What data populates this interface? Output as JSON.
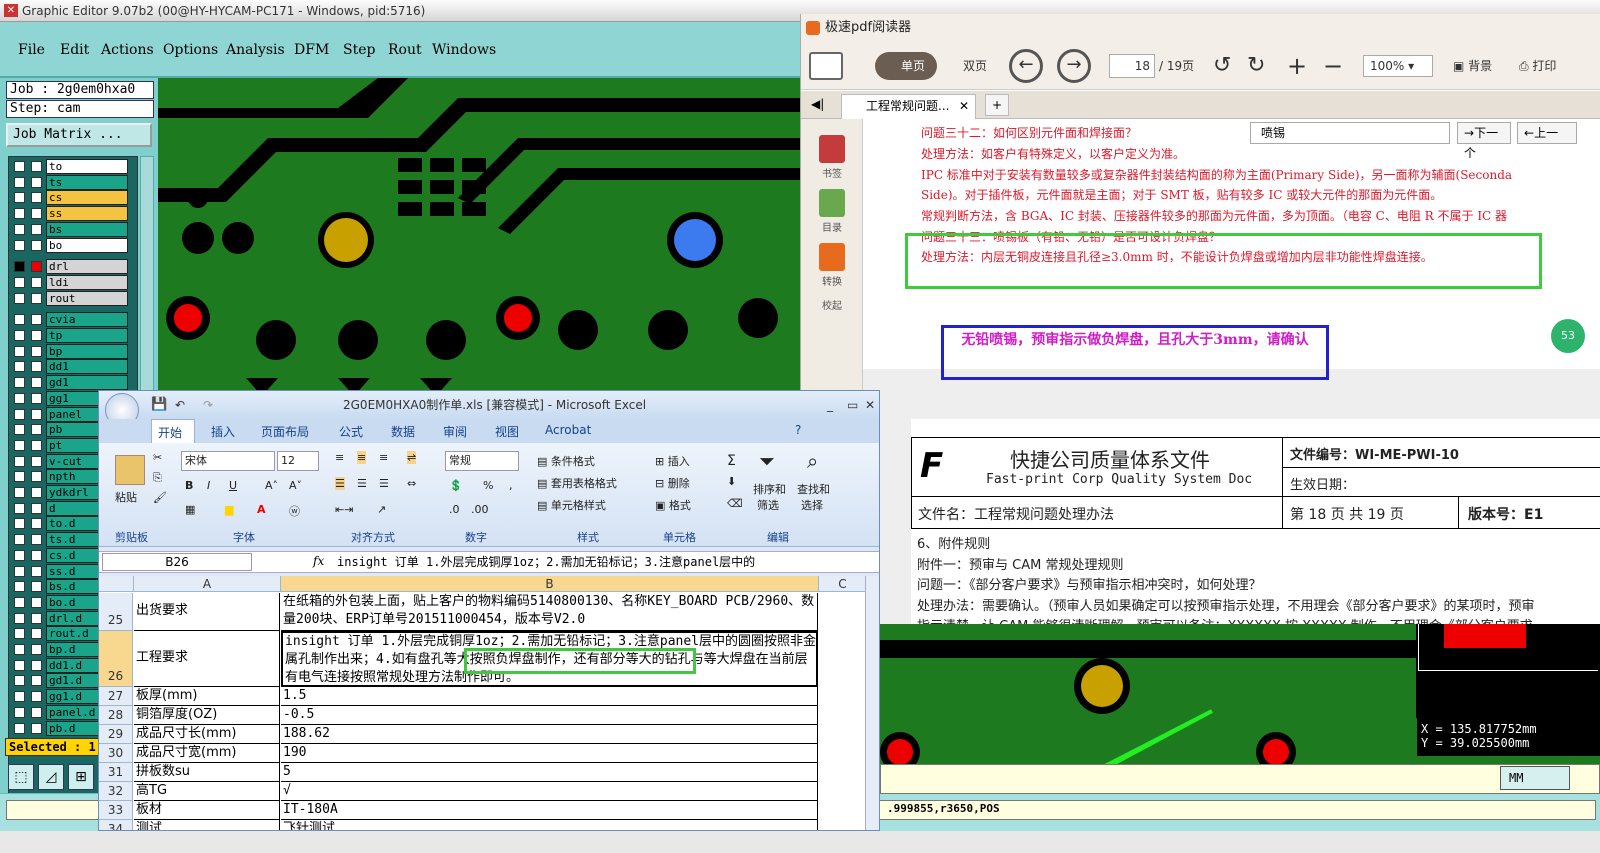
{
  "genesis": {
    "title": "Graphic Editor 9.07b2 (00@HY-HYCAM-PC171 - Windows, pid:5716)",
    "menu": [
      "File",
      "Edit",
      "Actions",
      "Options",
      "Analysis",
      "DFM",
      "Step",
      "Rout",
      "Windows"
    ],
    "job": "Job : 2g0em0hxa0",
    "step": "Step: cam",
    "job_matrix": "Job Matrix ...",
    "layers": [
      {
        "name": "to",
        "color": "#ffffff"
      },
      {
        "name": "ts",
        "color": "#1aa58a"
      },
      {
        "name": "cs",
        "color": "#f5c342"
      },
      {
        "name": "ss",
        "color": "#f5c342"
      },
      {
        "name": "bs",
        "color": "#1aa58a"
      },
      {
        "name": "bo",
        "color": "#ffffff"
      },
      {
        "name": "drl",
        "color": "#d4d4d4"
      },
      {
        "name": "ldi",
        "color": "#d4d4d4"
      },
      {
        "name": "rout",
        "color": "#d4d4d4"
      },
      {
        "name": "cvia",
        "color": "#1aa58a"
      },
      {
        "name": "tp",
        "color": "#1aa58a"
      },
      {
        "name": "bp",
        "color": "#1aa58a"
      },
      {
        "name": "dd1",
        "color": "#1aa58a"
      },
      {
        "name": "gd1",
        "color": "#1aa58a"
      },
      {
        "name": "gg1",
        "color": "#1aa58a"
      },
      {
        "name": "panel",
        "color": "#1aa58a"
      },
      {
        "name": "pb",
        "color": "#1aa58a"
      },
      {
        "name": "pt",
        "color": "#1aa58a"
      },
      {
        "name": "v-cut",
        "color": "#1aa58a"
      },
      {
        "name": "npth",
        "color": "#1aa58a"
      },
      {
        "name": "ydkdrl",
        "color": "#1aa58a"
      },
      {
        "name": "d",
        "color": "#1aa58a"
      },
      {
        "name": "to.d",
        "color": "#1aa58a"
      },
      {
        "name": "ts.d",
        "color": "#1aa58a"
      },
      {
        "name": "cs.d",
        "color": "#1aa58a"
      },
      {
        "name": "ss.d",
        "color": "#1aa58a"
      },
      {
        "name": "bs.d",
        "color": "#1aa58a"
      },
      {
        "name": "bo.d",
        "color": "#1aa58a"
      },
      {
        "name": "drl.d",
        "color": "#1aa58a"
      },
      {
        "name": "rout.d",
        "color": "#1aa58a"
      },
      {
        "name": "bp.d",
        "color": "#1aa58a"
      },
      {
        "name": "dd1.d",
        "color": "#1aa58a"
      },
      {
        "name": "gd1.d",
        "color": "#1aa58a"
      },
      {
        "name": "gg1.d",
        "color": "#1aa58a"
      },
      {
        "name": "panel.d",
        "color": "#1aa58a"
      },
      {
        "name": "pb.d",
        "color": "#1aa58a"
      }
    ],
    "selected": "Selected : 1",
    "coords": [
      "X = 135.817752mm",
      "Y = 39.025500mm"
    ],
    "units": "MM",
    "command": ".999855,r3650,POS"
  },
  "pdf": {
    "title": "极速pdf阅读器",
    "single_page": "单页",
    "double_page": "双页",
    "page_input": "18",
    "page_total": "/ 19页",
    "zoom": "100%",
    "background": "背景",
    "print": "打印",
    "tab": "工程常规问题...",
    "search": "喷锡",
    "next": "下一个",
    "prev": "上一",
    "side": [
      "书签",
      "目录",
      "转换",
      "校起"
    ],
    "lines": [
      "问题三十二：如何区别元件面和焊接面？",
      "处理方法：如客户有特殊定义，以客户定义为准。",
      "IPC 标准中对于安装有数量较多或复杂器件封装结构面的称为主面(Primary Side)，另一面称为辅面(Seconda",
      "Side)。对于插件板，元件面就是主面；对于 SMT 板，贴有较多 IC 或较大元件的那面为元件面。",
      "常规判断方法，含 BGA、IC 封装、压接器件较多的那面为元件面，多为顶面。（电容 C、电阻 R 不属于 IC 器",
      "问题三十三：喷锡板（有铅、无铅）是否可设计负焊盘？",
      "处理方法：内层无铜皮连接且孔径≥3.0mm 时，不能设计负焊盘或增加内层非功能性焊盘连接。"
    ],
    "note": "无铅喷锡，预审指示做负焊盘，且孔大于3mm，请确认",
    "badge": "53",
    "doc": {
      "company_cn": "快捷公司质量体系文件",
      "company_en": "Fast-print Corp Quality System Doc",
      "doc_no": "文件编号：WI-ME-PWI-10",
      "effective": "生效日期：",
      "file_name": "文件名：工程常规问题处理办法",
      "page_info": "第 18 页 共 19 页",
      "version": "版本号：E1",
      "body": [
        "6、附件规则",
        "附件一：预审与 CAM 常规处理规则",
        "问题一：《部分客户要求》与预审指示相冲突时，如何处理？",
        "处理办法：需要确认。（预审人员如果确定可以按预审指示处理，不用理会《部分客户要求》的某项时，预审",
        "指示清楚，让 CAM 能够很清晰理解，预审可以备注：XXXXXX 按 XXXXX 制作，不用理会《部分客户要求"
      ]
    }
  },
  "excel": {
    "title": "2G0EM0HXA0制作单.xls  [兼容模式] - Microsoft Excel",
    "tabs": [
      "开始",
      "插入",
      "页面布局",
      "公式",
      "数据",
      "审阅",
      "视图",
      "Acrobat"
    ],
    "font": "宋体",
    "font_size": "12",
    "number_format": "常规",
    "paste": "粘贴",
    "groups": [
      "剪贴板",
      "字体",
      "对齐方式",
      "数字",
      "样式",
      "单元格",
      "编辑"
    ],
    "style_btns": [
      "条件格式",
      "套用表格格式",
      "单元格样式"
    ],
    "cell_btns": [
      "插入",
      "删除",
      "格式"
    ],
    "edit_btns": [
      "排序和",
      "筛选",
      "查找和",
      "选择"
    ],
    "name_box": "B26",
    "formula": "insight 订单 1.外层完成铜厚1oz；2.需加无铅标记；3.注意panel层中的",
    "cols": [
      "A",
      "B",
      "C"
    ],
    "rows": [
      {
        "n": "25",
        "a": "出货要求",
        "b": "在纸箱的外包装上面，贴上客户的物料编码5140800130、名称KEY_BOARD PCB/2960、数量200块、ERP订单号201511000454，版本号V2.0"
      },
      {
        "n": "26",
        "a": "工程要求",
        "b": "insight 订单 1.外层完成铜厚1oz；2.需加无铅标记；3.注意panel层中的圆圈按照非金属孔制作出来；4.如有盘孔等大按照负焊盘制作，还有部分等大的钻孔与等大焊盘在当前层有电气连接按照常规处理方法制作即可。"
      },
      {
        "n": "27",
        "a": "板厚(mm)",
        "b": "1.5"
      },
      {
        "n": "28",
        "a": "铜箔厚度(OZ)",
        "b": "-0.5"
      },
      {
        "n": "29",
        "a": "成品尺寸长(mm)",
        "b": "188.62"
      },
      {
        "n": "30",
        "a": "成品尺寸宽(mm)",
        "b": "190"
      },
      {
        "n": "31",
        "a": "拼板数su",
        "b": "5"
      },
      {
        "n": "32",
        "a": "高TG",
        "b": "√"
      },
      {
        "n": "33",
        "a": "板材",
        "b": "IT-180A"
      },
      {
        "n": "34",
        "a": "测试",
        "b": "飞针测试"
      }
    ]
  }
}
